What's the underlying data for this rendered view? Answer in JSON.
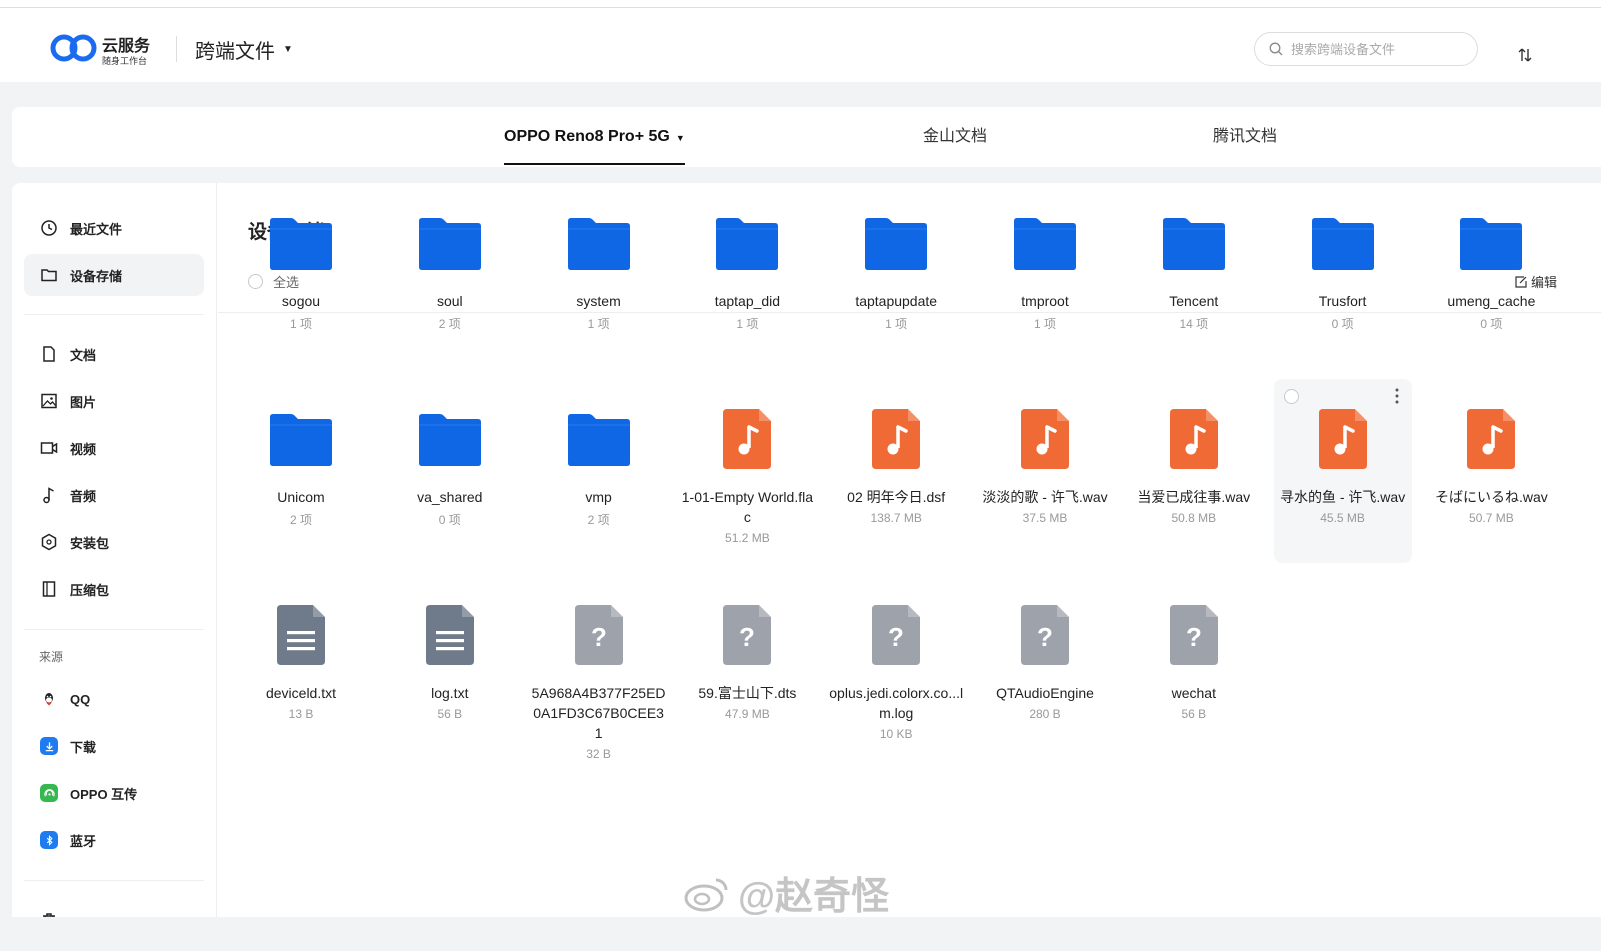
{
  "header": {
    "logo_text": "云服务",
    "logo_sub": "随身工作台",
    "app_title": "跨端文件",
    "search_placeholder": "搜索跨端设备文件"
  },
  "source_tabs": [
    {
      "label": "OPPO Reno8 Pro+ 5G",
      "active": true
    },
    {
      "label": "金山文档",
      "active": false
    },
    {
      "label": "腾讯文档",
      "active": false
    }
  ],
  "sidebar": {
    "primary": [
      {
        "label": "最近文件",
        "icon": "clock-icon"
      },
      {
        "label": "设备存储",
        "icon": "folder-icon",
        "active": true
      }
    ],
    "types": [
      {
        "label": "文档",
        "icon": "document-icon"
      },
      {
        "label": "图片",
        "icon": "image-icon"
      },
      {
        "label": "视频",
        "icon": "video-icon"
      },
      {
        "label": "音频",
        "icon": "music-icon"
      },
      {
        "label": "安装包",
        "icon": "package-icon"
      },
      {
        "label": "压缩包",
        "icon": "archive-icon"
      }
    ],
    "sources_heading": "来源",
    "sources": [
      {
        "label": "QQ",
        "icon": "qq-icon"
      },
      {
        "label": "下载",
        "icon": "download-icon",
        "color": "#1f7cf0"
      },
      {
        "label": "OPPO 互传",
        "icon": "share-icon",
        "color": "#34b84f"
      },
      {
        "label": "蓝牙",
        "icon": "bluetooth-icon",
        "color": "#1f7cf0"
      }
    ]
  },
  "content": {
    "title": "设备存储",
    "select_all": "全选",
    "edit": "编辑"
  },
  "files": [
    {
      "name": "sogou",
      "meta": "1 项",
      "kind": "folder"
    },
    {
      "name": "soul",
      "meta": "2 项",
      "kind": "folder"
    },
    {
      "name": "system",
      "meta": "1 项",
      "kind": "folder"
    },
    {
      "name": "taptap_did",
      "meta": "1 项",
      "kind": "folder"
    },
    {
      "name": "taptapupdate",
      "meta": "1 项",
      "kind": "folder"
    },
    {
      "name": "tmproot",
      "meta": "1 项",
      "kind": "folder"
    },
    {
      "name": "Tencent",
      "meta": "14 项",
      "kind": "folder"
    },
    {
      "name": "Trusfort",
      "meta": "0 项",
      "kind": "folder"
    },
    {
      "name": "umeng_cache",
      "meta": "0 项",
      "kind": "folder"
    },
    {
      "name": "Unicom",
      "meta": "2 项",
      "kind": "folder"
    },
    {
      "name": "va_shared",
      "meta": "0 项",
      "kind": "folder"
    },
    {
      "name": "vmp",
      "meta": "2 项",
      "kind": "folder"
    },
    {
      "name": "1-01-Empty World.flac",
      "meta": "51.2 MB",
      "kind": "audio"
    },
    {
      "name": "02 明年今日.dsf",
      "meta": "138.7 MB",
      "kind": "audio"
    },
    {
      "name": "淡淡的歌 - 许飞.wav",
      "meta": "37.5 MB",
      "kind": "audio"
    },
    {
      "name": "当爱已成往事.wav",
      "meta": "50.8 MB",
      "kind": "audio"
    },
    {
      "name": "寻水的鱼 - 许飞.wav",
      "meta": "45.5 MB",
      "kind": "audio",
      "hover": true
    },
    {
      "name": "そばにいるね.wav",
      "meta": "50.7 MB",
      "kind": "audio"
    },
    {
      "name": "deviceld.txt",
      "meta": "13 B",
      "kind": "text"
    },
    {
      "name": "log.txt",
      "meta": "56 B",
      "kind": "text"
    },
    {
      "name": "5A968A4B377F25ED0A1FD3C67B0CEE31",
      "meta": "32 B",
      "kind": "unknown"
    },
    {
      "name": "59.富士山下.dts",
      "meta": "47.9 MB",
      "kind": "unknown"
    },
    {
      "name": "oplus.jedi.colorx.co...lm.log",
      "meta": "10 KB",
      "kind": "unknown"
    },
    {
      "name": "QTAudioEngine",
      "meta": "280 B",
      "kind": "unknown"
    },
    {
      "name": "wechat",
      "meta": "56 B",
      "kind": "unknown"
    }
  ],
  "watermark": "@赵奇怪",
  "colors": {
    "folder": "#1067e6",
    "audio": "#f06a35",
    "text": "#6f7a8a",
    "unknown": "#9ea3ab",
    "logo": "#1a6bf0"
  }
}
